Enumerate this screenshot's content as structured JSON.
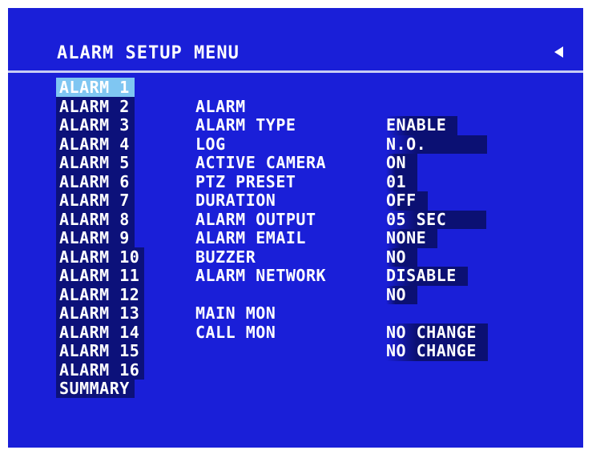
{
  "menu": {
    "title": "ALARM SETUP MENU",
    "back_icon": "triangle-left-icon"
  },
  "alarms": [
    "ALARM 1",
    "ALARM 2",
    "ALARM 3",
    "ALARM 4",
    "ALARM 5",
    "ALARM 6",
    "ALARM 7",
    "ALARM 8",
    "ALARM 9",
    "ALARM 10",
    "ALARM 11",
    "ALARM 12",
    "ALARM 13",
    "ALARM 14",
    "ALARM 15",
    "ALARM 16",
    "SUMMARY"
  ],
  "selected_alarm": "ALARM 1",
  "settings": [
    {
      "label": "ALARM",
      "value": "ENABLE"
    },
    {
      "label": "ALARM TYPE",
      "value": "N.O."
    },
    {
      "label": "LOG",
      "value": "ON"
    },
    {
      "label": "ACTIVE CAMERA",
      "value": "01"
    },
    {
      "label": "PTZ PRESET",
      "value": "OFF"
    },
    {
      "label": "DURATION",
      "value": "05 SEC"
    },
    {
      "label": "ALARM OUTPUT",
      "value": "NONE"
    },
    {
      "label": "ALARM EMAIL",
      "value": "NO"
    },
    {
      "label": "BUZZER",
      "value": "DISABLE"
    },
    {
      "label": "ALARM NETWORK",
      "value": "NO"
    }
  ],
  "monitors": [
    {
      "label": "MAIN MON",
      "value": "NO CHANGE"
    },
    {
      "label": "CALL MON",
      "value": "NO CHANGE"
    }
  ],
  "colors": {
    "background": "#1a1fd8",
    "highlight": "#7fc6f2",
    "field": "#0b1073",
    "text": "#ffffff"
  }
}
